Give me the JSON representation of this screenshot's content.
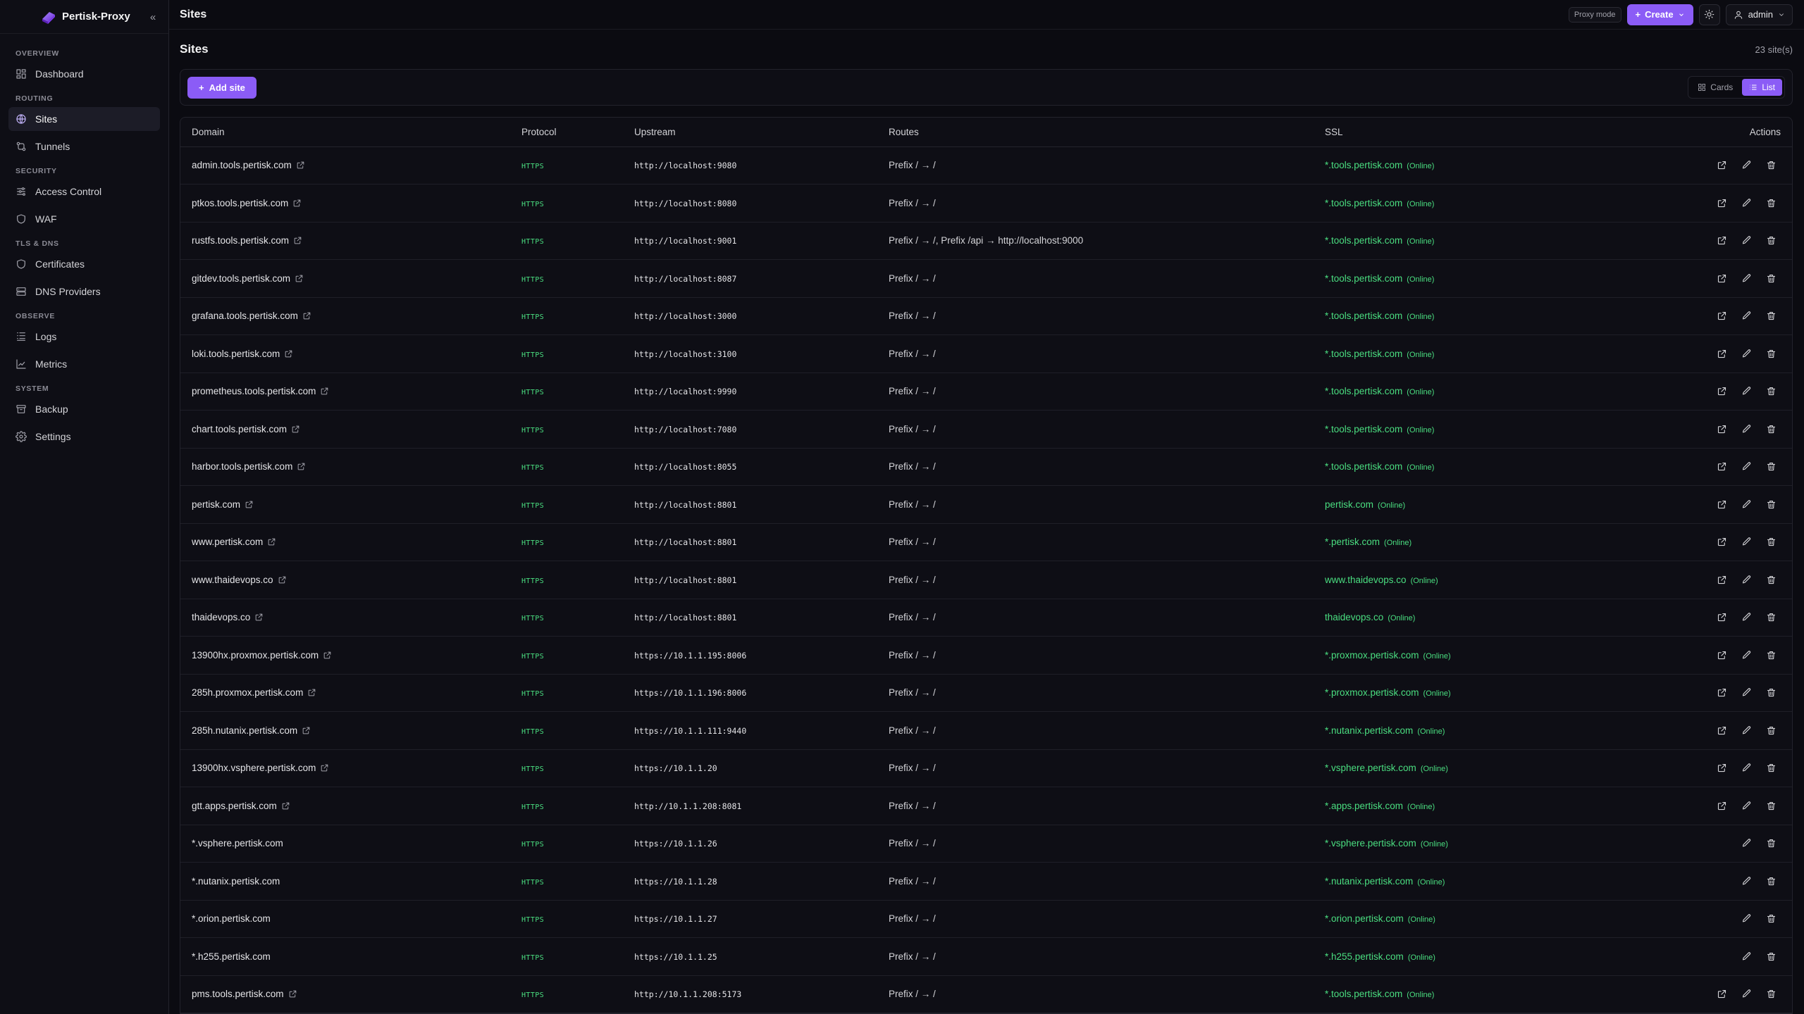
{
  "brand": {
    "name": "Pertisk-Proxy"
  },
  "sidebar": {
    "sections": [
      {
        "title": "OVERVIEW",
        "items": [
          {
            "label": "Dashboard",
            "icon": "dashboard-icon"
          }
        ]
      },
      {
        "title": "ROUTING",
        "items": [
          {
            "label": "Sites",
            "icon": "globe-icon",
            "active": true
          },
          {
            "label": "Tunnels",
            "icon": "tunnel-icon"
          }
        ]
      },
      {
        "title": "SECURITY",
        "items": [
          {
            "label": "Access Control",
            "icon": "sliders-icon"
          },
          {
            "label": "WAF",
            "icon": "shield-icon"
          }
        ]
      },
      {
        "title": "TLS & DNS",
        "items": [
          {
            "label": "Certificates",
            "icon": "shield-icon"
          },
          {
            "label": "DNS Providers",
            "icon": "server-icon"
          }
        ]
      },
      {
        "title": "OBSERVE",
        "items": [
          {
            "label": "Logs",
            "icon": "logs-icon"
          },
          {
            "label": "Metrics",
            "icon": "chart-icon"
          }
        ]
      },
      {
        "title": "SYSTEM",
        "items": [
          {
            "label": "Backup",
            "icon": "archive-icon"
          },
          {
            "label": "Settings",
            "icon": "gear-icon"
          }
        ]
      }
    ]
  },
  "topbar": {
    "title": "Sites",
    "mode": "Proxy mode",
    "create": "Create",
    "user": "admin"
  },
  "page": {
    "title": "Sites",
    "count": "23 site(s)",
    "add_label": "Add site",
    "view_cards": "Cards",
    "view_list": "List"
  },
  "table": {
    "headers": {
      "domain": "Domain",
      "protocol": "Protocol",
      "upstream": "Upstream",
      "routes": "Routes",
      "ssl": "SSL",
      "actions": "Actions"
    },
    "rows": [
      {
        "domain": "admin.tools.pertisk.com",
        "ext": true,
        "protocol": "HTTPS",
        "upstream": "http://localhost:9080",
        "routes": "Prefix / → /",
        "ssl": "*.tools.pertisk.com",
        "status": "(Online)"
      },
      {
        "domain": "ptkos.tools.pertisk.com",
        "ext": true,
        "protocol": "HTTPS",
        "upstream": "http://localhost:8080",
        "routes": "Prefix / → /",
        "ssl": "*.tools.pertisk.com",
        "status": "(Online)"
      },
      {
        "domain": "rustfs.tools.pertisk.com",
        "ext": true,
        "protocol": "HTTPS",
        "upstream": "http://localhost:9001",
        "routes": "Prefix / → /, Prefix /api → http://localhost:9000",
        "ssl": "*.tools.pertisk.com",
        "status": "(Online)"
      },
      {
        "domain": "gitdev.tools.pertisk.com",
        "ext": true,
        "protocol": "HTTPS",
        "upstream": "http://localhost:8087",
        "routes": "Prefix / → /",
        "ssl": "*.tools.pertisk.com",
        "status": "(Online)"
      },
      {
        "domain": "grafana.tools.pertisk.com",
        "ext": true,
        "protocol": "HTTPS",
        "upstream": "http://localhost:3000",
        "routes": "Prefix / → /",
        "ssl": "*.tools.pertisk.com",
        "status": "(Online)"
      },
      {
        "domain": "loki.tools.pertisk.com",
        "ext": true,
        "protocol": "HTTPS",
        "upstream": "http://localhost:3100",
        "routes": "Prefix / → /",
        "ssl": "*.tools.pertisk.com",
        "status": "(Online)"
      },
      {
        "domain": "prometheus.tools.pertisk.com",
        "ext": true,
        "protocol": "HTTPS",
        "upstream": "http://localhost:9990",
        "routes": "Prefix / → /",
        "ssl": "*.tools.pertisk.com",
        "status": "(Online)"
      },
      {
        "domain": "chart.tools.pertisk.com",
        "ext": true,
        "protocol": "HTTPS",
        "upstream": "http://localhost:7080",
        "routes": "Prefix / → /",
        "ssl": "*.tools.pertisk.com",
        "status": "(Online)"
      },
      {
        "domain": "harbor.tools.pertisk.com",
        "ext": true,
        "protocol": "HTTPS",
        "upstream": "http://localhost:8055",
        "routes": "Prefix / → /",
        "ssl": "*.tools.pertisk.com",
        "status": "(Online)"
      },
      {
        "domain": "pertisk.com",
        "ext": true,
        "protocol": "HTTPS",
        "upstream": "http://localhost:8801",
        "routes": "Prefix / → /",
        "ssl": "pertisk.com",
        "status": "(Online)"
      },
      {
        "domain": "www.pertisk.com",
        "ext": true,
        "protocol": "HTTPS",
        "upstream": "http://localhost:8801",
        "routes": "Prefix / → /",
        "ssl": "*.pertisk.com",
        "status": "(Online)"
      },
      {
        "domain": "www.thaidevops.co",
        "ext": true,
        "protocol": "HTTPS",
        "upstream": "http://localhost:8801",
        "routes": "Prefix / → /",
        "ssl": "www.thaidevops.co",
        "status": "(Online)"
      },
      {
        "domain": "thaidevops.co",
        "ext": true,
        "protocol": "HTTPS",
        "upstream": "http://localhost:8801",
        "routes": "Prefix / → /",
        "ssl": "thaidevops.co",
        "status": "(Online)"
      },
      {
        "domain": "13900hx.proxmox.pertisk.com",
        "ext": true,
        "protocol": "HTTPS",
        "upstream": "https://10.1.1.195:8006",
        "routes": "Prefix / → /",
        "ssl": "*.proxmox.pertisk.com",
        "status": "(Online)"
      },
      {
        "domain": "285h.proxmox.pertisk.com",
        "ext": true,
        "protocol": "HTTPS",
        "upstream": "https://10.1.1.196:8006",
        "routes": "Prefix / → /",
        "ssl": "*.proxmox.pertisk.com",
        "status": "(Online)"
      },
      {
        "domain": "285h.nutanix.pertisk.com",
        "ext": true,
        "protocol": "HTTPS",
        "upstream": "https://10.1.1.111:9440",
        "routes": "Prefix / → /",
        "ssl": "*.nutanix.pertisk.com",
        "status": "(Online)"
      },
      {
        "domain": "13900hx.vsphere.pertisk.com",
        "ext": true,
        "protocol": "HTTPS",
        "upstream": "https://10.1.1.20",
        "routes": "Prefix / → /",
        "ssl": "*.vsphere.pertisk.com",
        "status": "(Online)"
      },
      {
        "domain": "gtt.apps.pertisk.com",
        "ext": true,
        "protocol": "HTTPS",
        "upstream": "http://10.1.1.208:8081",
        "routes": "Prefix / → /",
        "ssl": "*.apps.pertisk.com",
        "status": "(Online)"
      },
      {
        "domain": "*.vsphere.pertisk.com",
        "ext": false,
        "protocol": "HTTPS",
        "upstream": "https://10.1.1.26",
        "routes": "Prefix / → /",
        "ssl": "*.vsphere.pertisk.com",
        "status": "(Online)"
      },
      {
        "domain": "*.nutanix.pertisk.com",
        "ext": false,
        "protocol": "HTTPS",
        "upstream": "https://10.1.1.28",
        "routes": "Prefix / → /",
        "ssl": "*.nutanix.pertisk.com",
        "status": "(Online)"
      },
      {
        "domain": "*.orion.pertisk.com",
        "ext": false,
        "protocol": "HTTPS",
        "upstream": "https://10.1.1.27",
        "routes": "Prefix / → /",
        "ssl": "*.orion.pertisk.com",
        "status": "(Online)"
      },
      {
        "domain": "*.h255.pertisk.com",
        "ext": false,
        "protocol": "HTTPS",
        "upstream": "https://10.1.1.25",
        "routes": "Prefix / → /",
        "ssl": "*.h255.pertisk.com",
        "status": "(Online)"
      },
      {
        "domain": "pms.tools.pertisk.com",
        "ext": true,
        "protocol": "HTTPS",
        "upstream": "http://10.1.1.208:5173",
        "routes": "Prefix / → /",
        "ssl": "*.tools.pertisk.com",
        "status": "(Online)"
      }
    ]
  }
}
